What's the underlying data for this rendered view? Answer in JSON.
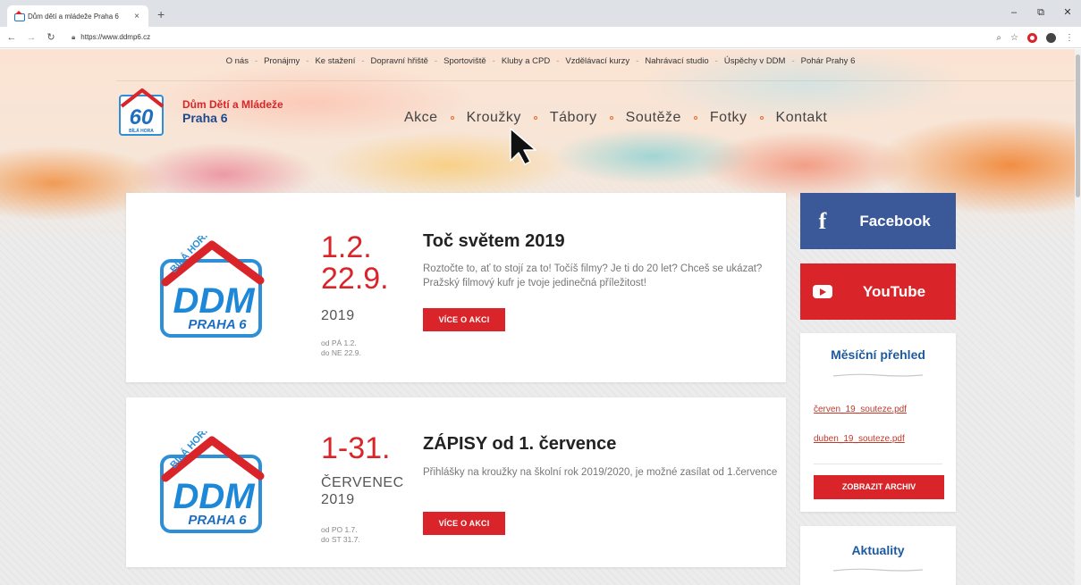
{
  "browser": {
    "tab_title": "Dům dětí a mládeže Praha 6",
    "tab_close": "×",
    "new_tab": "+",
    "url": "https://www.ddmp6.cz",
    "window_controls": {
      "minimize": "–",
      "restore": "⧉",
      "close": "✕"
    }
  },
  "top_nav": [
    "O nás",
    "Pronájmy",
    "Ke stažení",
    "Dopravní hřiště",
    "Sportoviště",
    "Kluby a CPD",
    "Vzdělávací kurzy",
    "Nahrávací studio",
    "Úspěchy v DDM",
    "Pohár Prahy 6"
  ],
  "top_nav_separator": "-",
  "brand": {
    "line1": "Dům Dětí a Mládeže",
    "line2": "Praha 6",
    "badge": "60",
    "badge_caption": "BÍLÁ HORA"
  },
  "main_nav": [
    "Akce",
    "Kroužky",
    "Tábory",
    "Soutěže",
    "Fotky",
    "Kontakt"
  ],
  "logo": {
    "arc": "BÍLÁ HORA",
    "main": "DDM",
    "sub": "PRAHA 6"
  },
  "events": [
    {
      "date_lines": [
        "1.2.",
        "22.9."
      ],
      "unit_lines": [
        "2019"
      ],
      "sub_lines": [
        "od PÁ 1.2.",
        "do NE 22.9."
      ],
      "title": "Toč světem 2019",
      "description": "Roztočte to, ať to stojí za to! Točíš filmy? Je ti do 20 let? Chceš se ukázat? Pražský filmový kufr je tvoje jedinečná příležitost!",
      "button": "VÍCE O AKCI"
    },
    {
      "date_lines": [
        "1-31."
      ],
      "unit_lines": [
        "ČERVENEC",
        "2019"
      ],
      "sub_lines": [
        "od PO 1.7.",
        "do ST 31.7."
      ],
      "title": "ZÁPISY od 1. července",
      "description": "Přihlášky na kroužky na školní rok 2019/2020, je možné zasílat od 1.července",
      "button": "VÍCE O AKCI"
    }
  ],
  "sidebar": {
    "facebook": {
      "icon": "f",
      "label": "Facebook",
      "color": "#3b5998"
    },
    "youtube": {
      "label": "YouTube",
      "color": "#d9252a"
    },
    "monthly": {
      "title": "Měsíční přehled",
      "links": [
        "červen_19_souteze.pdf",
        "duben_19_souteze.pdf"
      ],
      "archive_button": "ZOBRAZIT ARCHIV"
    },
    "news": {
      "title": "Aktuality"
    }
  },
  "colors": {
    "accent_red": "#d9252a",
    "brand_blue": "#1e5aa0"
  }
}
